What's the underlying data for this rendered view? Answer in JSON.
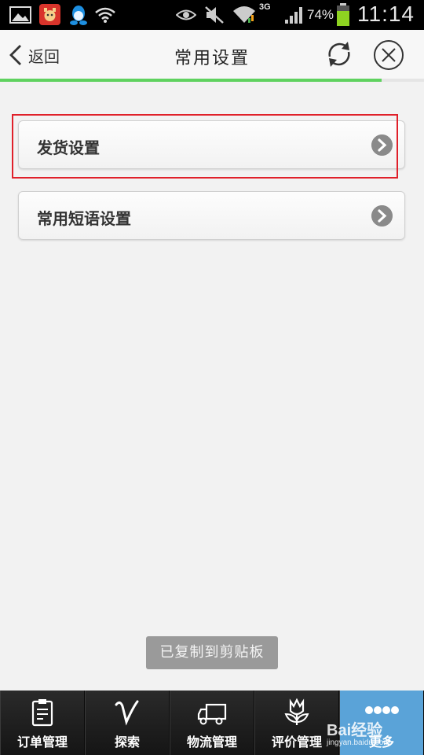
{
  "status_bar": {
    "network": "3G",
    "battery_percent": "74%",
    "time": "11:14",
    "icons": [
      "gallery-icon",
      "app-cow-icon",
      "qq-icon",
      "wifi-icon",
      "eye-icon",
      "mute-icon",
      "wifi-signal-icon",
      "cell-signal-icon",
      "battery-icon"
    ]
  },
  "header": {
    "back_label": "返回",
    "title": "常用设置",
    "load_progress": 0.9
  },
  "settings": [
    {
      "label": "发货设置"
    },
    {
      "label": "常用短语设置"
    }
  ],
  "toast": "已复制到剪贴板",
  "bottom_nav": [
    {
      "label": "订单管理",
      "icon": "clipboard-icon"
    },
    {
      "label": "探索",
      "icon": "explore-v-icon"
    },
    {
      "label": "物流管理",
      "icon": "truck-icon"
    },
    {
      "label": "评价管理",
      "icon": "flower-icon"
    },
    {
      "label": "更多",
      "icon": "more-dots-icon"
    }
  ],
  "watermark": {
    "brand": "Bai经验",
    "url": "jingyan.baidu.com"
  },
  "colors": {
    "accent_green": "#5fd25f",
    "highlight_red": "#e0202a",
    "nav_active": "#5aa3d8"
  }
}
